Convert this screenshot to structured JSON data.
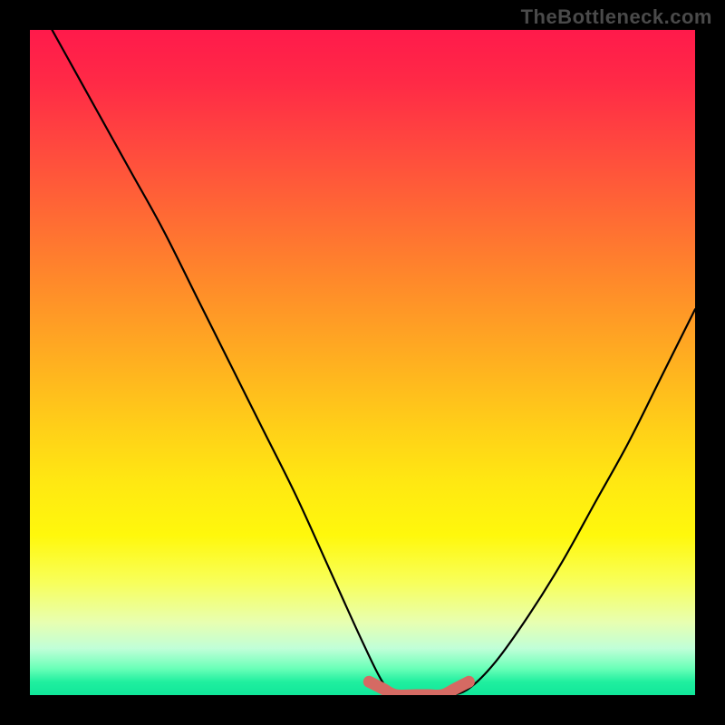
{
  "watermark": "TheBottleneck.com",
  "chart_data": {
    "type": "line",
    "title": "",
    "xlabel": "",
    "ylabel": "",
    "xlim": [
      0,
      100
    ],
    "ylim": [
      0,
      100
    ],
    "series": [
      {
        "name": "bottleneck-curve",
        "x": [
          0,
          5,
          10,
          15,
          20,
          25,
          30,
          35,
          40,
          45,
          50,
          53,
          55,
          58,
          60,
          63,
          66,
          70,
          75,
          80,
          85,
          90,
          95,
          100
        ],
        "values": [
          106,
          97,
          88,
          79,
          70,
          60,
          50,
          40,
          30,
          19,
          8,
          2,
          0,
          0,
          0,
          0,
          1,
          5,
          12,
          20,
          29,
          38,
          48,
          58
        ]
      },
      {
        "name": "optimal-band",
        "x": [
          51,
          53,
          55,
          58,
          60,
          62,
          64,
          66
        ],
        "values": [
          2,
          1,
          0,
          0,
          0,
          0,
          1,
          2
        ]
      }
    ],
    "gradient_stops": [
      {
        "pos": 0,
        "color": "#ff1a4b"
      },
      {
        "pos": 8,
        "color": "#ff2a46"
      },
      {
        "pos": 18,
        "color": "#ff4a3e"
      },
      {
        "pos": 28,
        "color": "#ff6a34"
      },
      {
        "pos": 38,
        "color": "#ff8a2a"
      },
      {
        "pos": 50,
        "color": "#ffb020"
      },
      {
        "pos": 60,
        "color": "#ffd018"
      },
      {
        "pos": 68,
        "color": "#ffe812"
      },
      {
        "pos": 76,
        "color": "#fff80c"
      },
      {
        "pos": 83,
        "color": "#f8ff5a"
      },
      {
        "pos": 89,
        "color": "#e8ffb0"
      },
      {
        "pos": 93,
        "color": "#c0ffd8"
      },
      {
        "pos": 96,
        "color": "#6affb8"
      },
      {
        "pos": 98,
        "color": "#20ef9f"
      },
      {
        "pos": 100,
        "color": "#10e79a"
      }
    ],
    "colors": {
      "curve": "#000000",
      "optimal_band": "#d56a63",
      "background_frame": "#000000"
    }
  }
}
